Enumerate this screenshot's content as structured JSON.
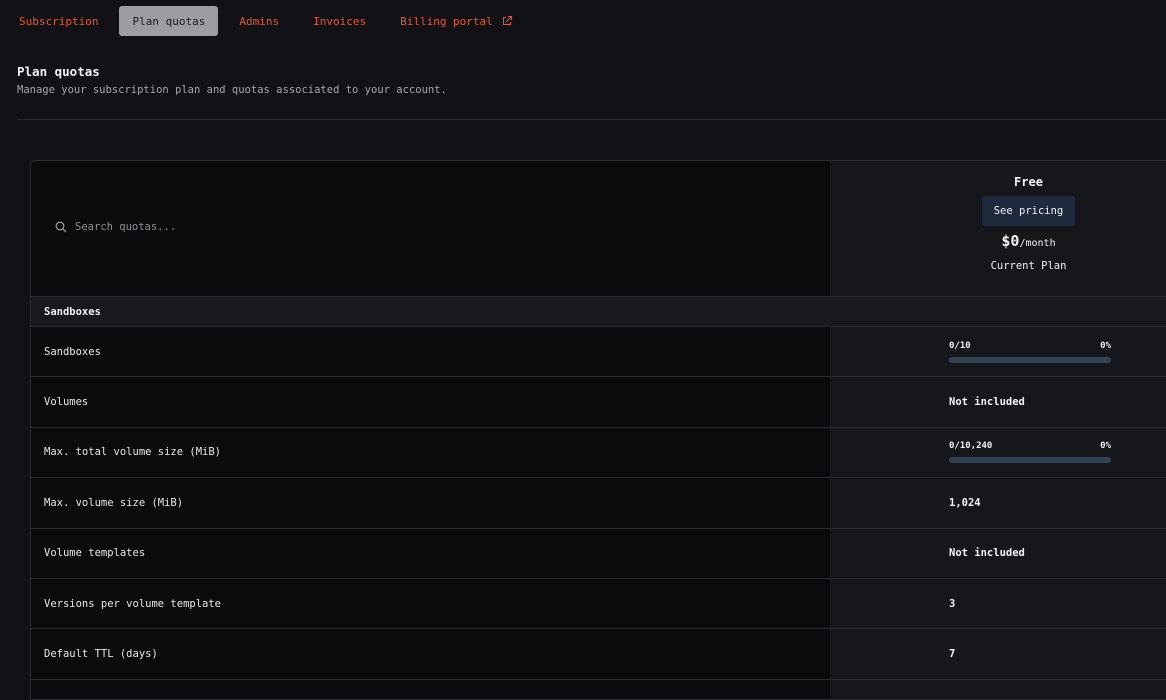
{
  "tabs": [
    {
      "label": "Subscription",
      "active": false
    },
    {
      "label": "Plan quotas",
      "active": true
    },
    {
      "label": "Admins",
      "active": false
    },
    {
      "label": "Invoices",
      "active": false
    },
    {
      "label": "Billing portal",
      "active": false,
      "icon": "external-link-icon"
    }
  ],
  "header": {
    "title": "Plan quotas",
    "subtitle": "Manage your subscription plan and quotas associated to your account."
  },
  "search": {
    "placeholder": "Search quotas...",
    "value": "",
    "icon": "search-icon"
  },
  "plan": {
    "name": "Free",
    "pricing_button": "See pricing",
    "price": "$0",
    "period": "/month",
    "status": "Current Plan"
  },
  "section": {
    "title": "Sandboxes"
  },
  "quotas": [
    {
      "label": "Sandboxes",
      "type": "progress",
      "usage": "0/10",
      "percent": "0%",
      "fraction": 0
    },
    {
      "label": "Volumes",
      "type": "text",
      "value": "Not included"
    },
    {
      "label": "Max. total volume size (MiB)",
      "type": "progress",
      "usage": "0/10,240",
      "percent": "0%",
      "fraction": 0
    },
    {
      "label": "Max. volume size (MiB)",
      "type": "text",
      "value": "1,024"
    },
    {
      "label": "Volume templates",
      "type": "text",
      "value": "Not included"
    },
    {
      "label": "Versions per volume template",
      "type": "text",
      "value": "3"
    },
    {
      "label": "Default TTL (days)",
      "type": "text",
      "value": "7"
    }
  ],
  "colors": {
    "accent": "#e8572a",
    "background": "#121116",
    "bar_track": "#344152",
    "pricing_button": "#1f2a3c"
  }
}
